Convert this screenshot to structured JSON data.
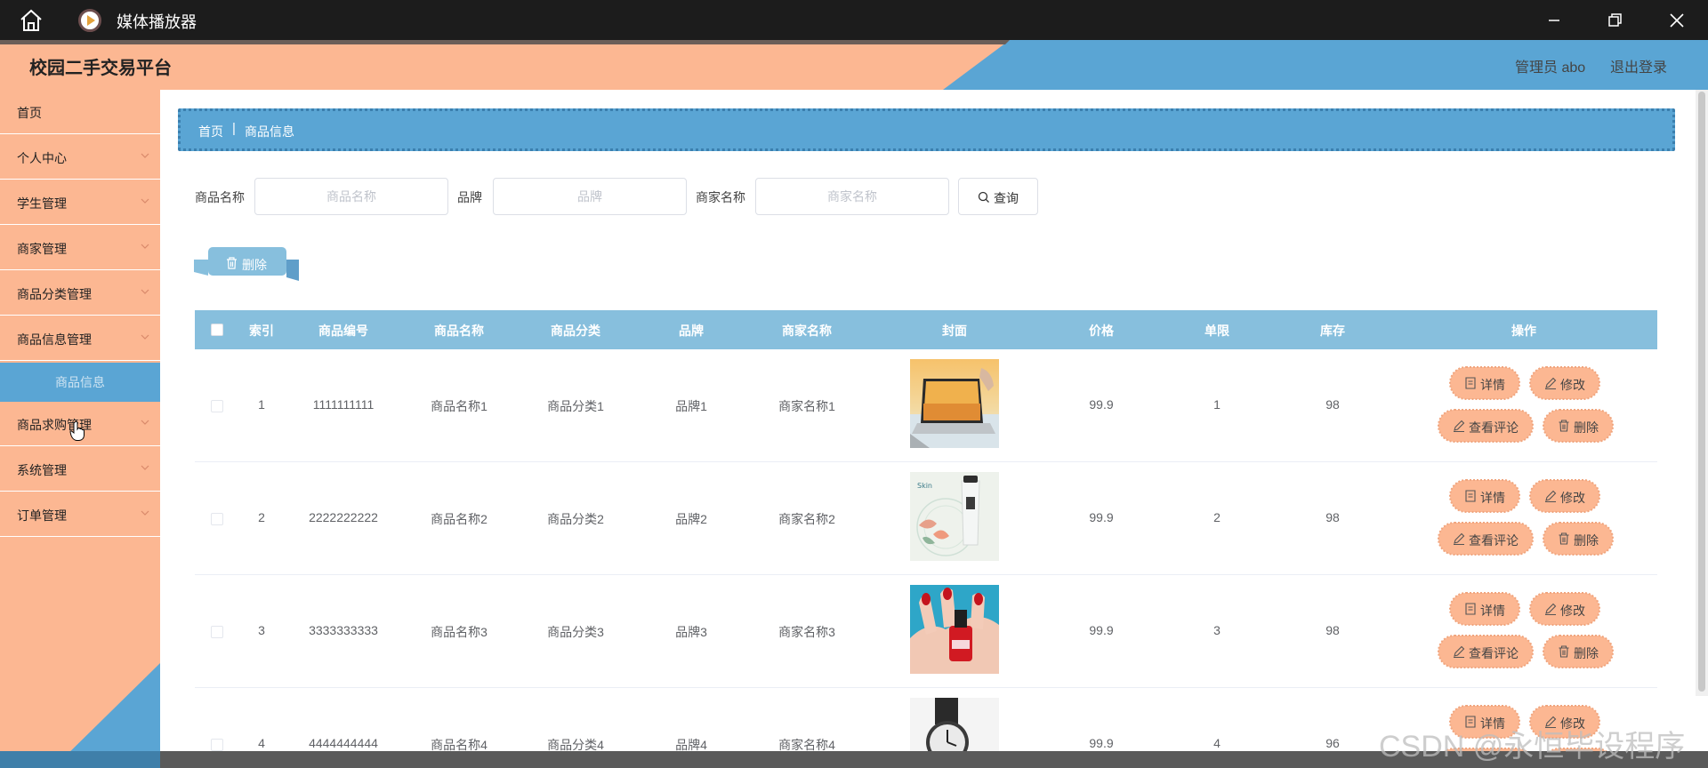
{
  "window": {
    "title": "媒体播放器",
    "icons": [
      "home-icon",
      "media-player-icon",
      "minimize-icon",
      "maximize-icon",
      "close-icon"
    ]
  },
  "header": {
    "brand": "校园二手交易平台",
    "admin": "管理员 abo",
    "logout": "退出登录"
  },
  "sidebar": {
    "items": [
      {
        "label": "首页"
      },
      {
        "label": "个人中心"
      },
      {
        "label": "学生管理"
      },
      {
        "label": "商家管理"
      },
      {
        "label": "商品分类管理"
      },
      {
        "label": "商品信息管理"
      },
      {
        "label": "商品求购管理"
      },
      {
        "label": "系统管理"
      },
      {
        "label": "订单管理"
      }
    ],
    "active_sub": "商品信息"
  },
  "breadcrumb": {
    "home": "首页",
    "separator": "|",
    "current": "商品信息"
  },
  "search": {
    "name_label": "商品名称",
    "name_placeholder": "商品名称",
    "brand_label": "品牌",
    "brand_placeholder": "品牌",
    "merchant_label": "商家名称",
    "merchant_placeholder": "商家名称",
    "query_button": "查询"
  },
  "batch_delete": "删除",
  "table": {
    "headers": [
      "索引",
      "商品编号",
      "商品名称",
      "商品分类",
      "品牌",
      "商家名称",
      "封面",
      "价格",
      "单限",
      "库存",
      "操作"
    ],
    "rows": [
      {
        "index": "1",
        "code": "1111111111",
        "name": "商品名称1",
        "category": "商品分类1",
        "brand": "品牌1",
        "merchant": "商家名称1",
        "cover": "laptop",
        "price": "99.9",
        "limit": "1",
        "stock": "98"
      },
      {
        "index": "2",
        "code": "2222222222",
        "name": "商品名称2",
        "category": "商品分类2",
        "brand": "品牌2",
        "merchant": "商家名称2",
        "cover": "cosmetic tube",
        "price": "99.9",
        "limit": "2",
        "stock": "98"
      },
      {
        "index": "3",
        "code": "3333333333",
        "name": "商品名称3",
        "category": "商品分类3",
        "brand": "品牌3",
        "merchant": "商家名称3",
        "cover": "nail polish",
        "price": "99.9",
        "limit": "3",
        "stock": "98"
      },
      {
        "index": "4",
        "code": "4444444444",
        "name": "商品名称4",
        "category": "商品分类4",
        "brand": "品牌4",
        "merchant": "商家名称4",
        "cover": "wrist watch",
        "price": "99.9",
        "limit": "4",
        "stock": "96"
      }
    ],
    "actions": {
      "detail": "详情",
      "edit": "修改",
      "comments": "查看评论",
      "delete": "删除"
    }
  },
  "watermark": "CSDN @永恒毕设程序",
  "colors": {
    "peach": "#fcb792",
    "blue": "#5aa5d4",
    "table_header": "#87bfdd",
    "action_badge": "#fcb792"
  }
}
